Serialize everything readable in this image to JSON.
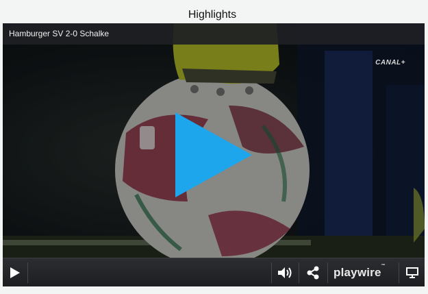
{
  "page": {
    "heading": "Highlights"
  },
  "player": {
    "title": "Hamburger SV 2-0 Schalke",
    "channel_logo": "CANAL+",
    "brand": "playwire",
    "brand_mark": "™"
  },
  "icons": {
    "big_play": "play-icon",
    "play": "play-icon",
    "volume": "volume-icon",
    "share": "share-icon",
    "fullscreen": "screen-icon"
  },
  "colors": {
    "play_overlay": "#1ea6ec",
    "control_bar": "#232529",
    "title_bar": "#1e2024"
  }
}
